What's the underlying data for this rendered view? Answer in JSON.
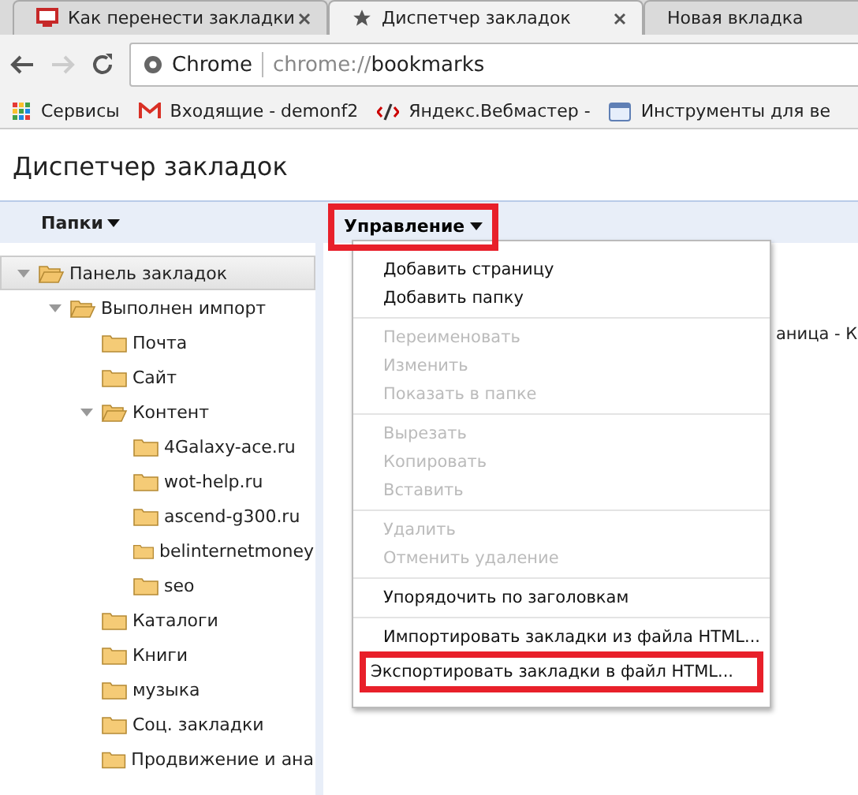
{
  "tabs": [
    {
      "title": "Как перенести закладки",
      "selected": false
    },
    {
      "title": "Диспетчер закладок",
      "selected": true
    },
    {
      "title": "Новая вкладка",
      "selected": false
    }
  ],
  "toolbar": {
    "site_label": "Chrome",
    "url_host": "chrome://",
    "url_path": "bookmarks"
  },
  "bookmarks_bar": [
    {
      "label": "Сервисы",
      "kind": "apps"
    },
    {
      "label": "Входящие - demonf2",
      "kind": "mail"
    },
    {
      "label": "Яндекс.Вебмастер -",
      "kind": "tools"
    },
    {
      "label": "Инструменты для ве",
      "kind": "page"
    }
  ],
  "page_title": "Диспетчер закладок",
  "header": {
    "folders_label": "Папки",
    "manage_button": {
      "label": "Управление",
      "highlighted": true
    }
  },
  "tree": [
    {
      "label": "Панель закладок",
      "selected": true,
      "expanded": true,
      "children": [
        {
          "label": "Выполнен импорт",
          "selected": false,
          "expanded": true,
          "children": [
            {
              "label": "Почта",
              "selected": false,
              "expanded": false
            },
            {
              "label": "Сайт",
              "selected": false,
              "expanded": false
            },
            {
              "label": "Контент",
              "selected": false,
              "expanded": true,
              "children": [
                {
                  "label": "4Galaxy-ace.ru",
                  "selected": false,
                  "expanded": false
                },
                {
                  "label": "wot-help.ru",
                  "selected": false,
                  "expanded": false
                },
                {
                  "label": "ascend-g300.ru",
                  "selected": false,
                  "expanded": false
                },
                {
                  "label": "belinternetmoney",
                  "selected": false,
                  "expanded": false
                },
                {
                  "label": "seo",
                  "selected": false,
                  "expanded": false
                }
              ]
            },
            {
              "label": "Каталоги",
              "selected": false,
              "expanded": false
            },
            {
              "label": "Книги",
              "selected": false,
              "expanded": false
            },
            {
              "label": "музыка",
              "selected": false,
              "expanded": false
            },
            {
              "label": "Соц. закладки",
              "selected": false,
              "expanded": false
            },
            {
              "label": "Продвижение и ана",
              "selected": false,
              "expanded": false
            }
          ]
        }
      ]
    }
  ],
  "content": {
    "visible_text": "аница - К"
  },
  "menu": [
    [
      {
        "label": "Добавить страницу",
        "disabled": false,
        "highlighted": false
      },
      {
        "label": "Добавить папку",
        "disabled": false,
        "highlighted": false
      }
    ],
    [
      {
        "label": "Переименовать",
        "disabled": true,
        "highlighted": false
      },
      {
        "label": "Изменить",
        "disabled": true,
        "highlighted": false
      },
      {
        "label": "Показать в папке",
        "disabled": true,
        "highlighted": false
      }
    ],
    [
      {
        "label": "Вырезать",
        "disabled": true,
        "highlighted": false
      },
      {
        "label": "Копировать",
        "disabled": true,
        "highlighted": false
      },
      {
        "label": "Вставить",
        "disabled": true,
        "highlighted": false
      }
    ],
    [
      {
        "label": "Удалить",
        "disabled": true,
        "highlighted": false
      },
      {
        "label": "Отменить удаление",
        "disabled": true,
        "highlighted": false
      }
    ],
    [
      {
        "label": "Упорядочить по заголовкам",
        "disabled": false,
        "highlighted": false
      }
    ],
    [
      {
        "label": "Импортировать закладки из файла HTML...",
        "disabled": false,
        "highlighted": false
      },
      {
        "label": "Экспортировать закладки в файл HTML...",
        "disabled": false,
        "highlighted": true
      }
    ]
  ]
}
